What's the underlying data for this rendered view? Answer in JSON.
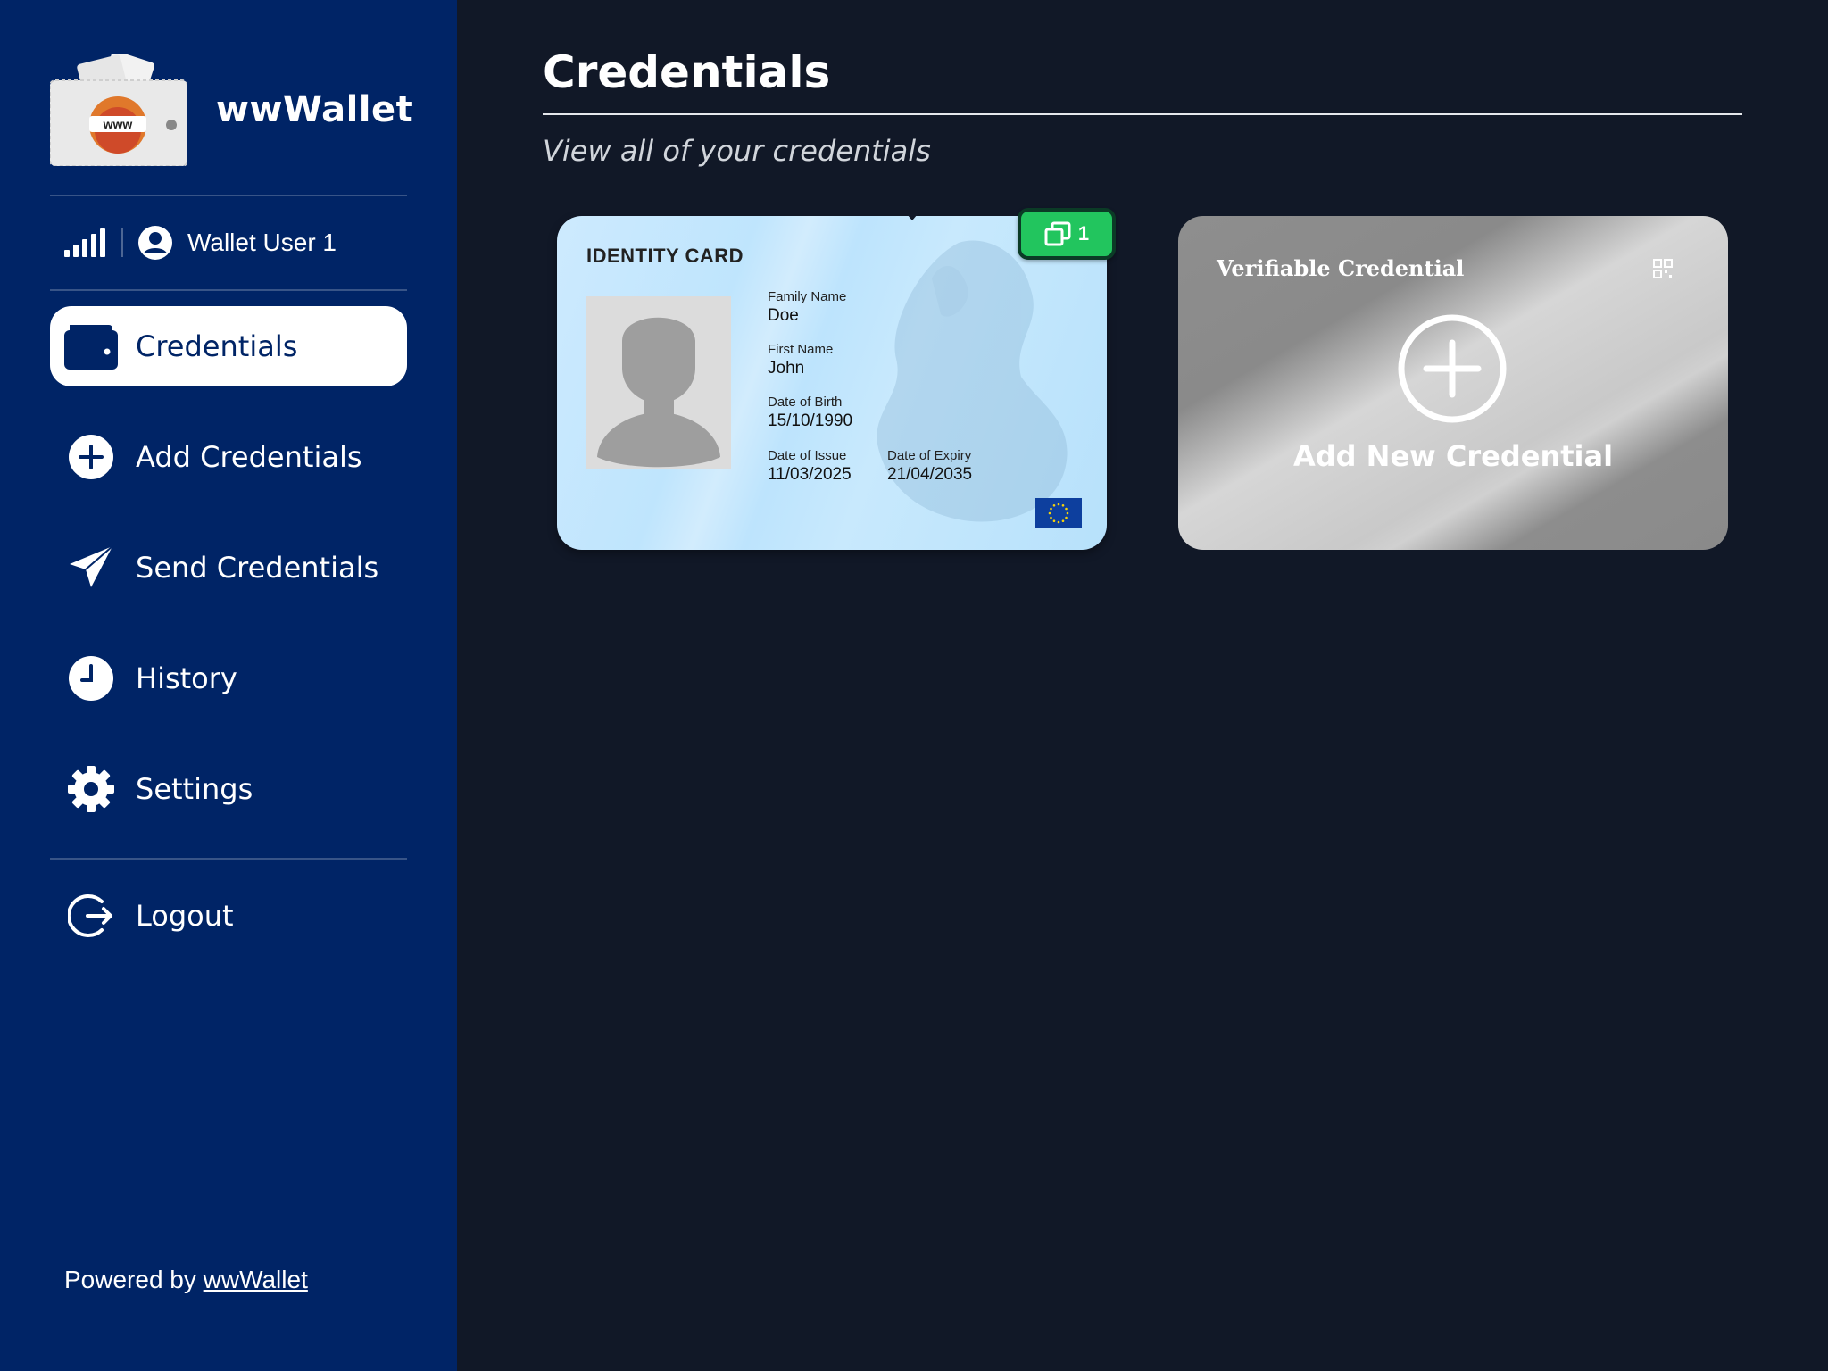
{
  "brand": {
    "name": "wwWallet",
    "logo_text": "www"
  },
  "user": {
    "name": "Wallet User 1"
  },
  "nav": {
    "items": [
      {
        "label": "Credentials",
        "icon": "wallet-icon",
        "active": true
      },
      {
        "label": "Add Credentials",
        "icon": "plus-circle-icon"
      },
      {
        "label": "Send Credentials",
        "icon": "send-icon"
      },
      {
        "label": "History",
        "icon": "clock-icon"
      },
      {
        "label": "Settings",
        "icon": "gear-icon"
      }
    ],
    "logout": {
      "label": "Logout",
      "icon": "logout-icon"
    }
  },
  "footer": {
    "prefix": "Powered by",
    "link": "wwWallet"
  },
  "main": {
    "title": "Credentials",
    "subtitle": "View all of your credentials"
  },
  "id_card": {
    "title": "IDENTITY CARD",
    "family_name_label": "Family Name",
    "family_name": "Doe",
    "first_name_label": "First Name",
    "first_name": "John",
    "dob_label": "Date of Birth",
    "dob": "15/10/1990",
    "issue_label": "Date of Issue",
    "issue": "11/03/2025",
    "expiry_label": "Date of Expiry",
    "expiry": "21/04/2035",
    "instances_count": "1"
  },
  "add_card": {
    "title": "Verifiable Credential",
    "label": "Add New Credential"
  },
  "colors": {
    "sidebar": "#002466",
    "background": "#111827",
    "badge": "#22c55e",
    "id_card": "#bfe5fd"
  }
}
